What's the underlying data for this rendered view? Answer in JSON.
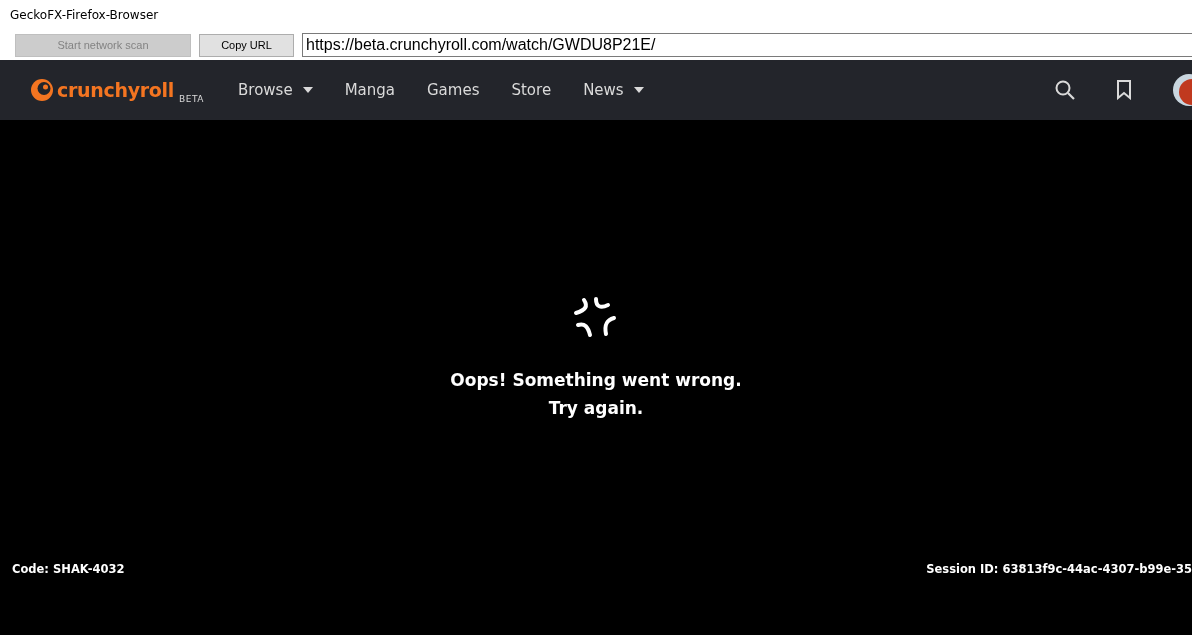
{
  "window": {
    "title": "GeckoFX-Firefox-Browser"
  },
  "toolbar": {
    "buttons": [
      {
        "label": "Start network scan",
        "disabled": true
      },
      {
        "label": "Copy URL",
        "disabled": false
      }
    ],
    "url": "https://beta.crunchyroll.com/watch/GWDU8P21E/"
  },
  "nav": {
    "logo": "crunchyroll",
    "badge": "BETA",
    "items": [
      {
        "label": "Browse",
        "dropdown": true
      },
      {
        "label": "Manga",
        "dropdown": false
      },
      {
        "label": "Games",
        "dropdown": false
      },
      {
        "label": "Store",
        "dropdown": false
      },
      {
        "label": "News",
        "dropdown": true
      }
    ]
  },
  "error": {
    "lines": [
      "Oops! Something went wrong.",
      "Try again."
    ],
    "code": "Code: SHAK-4032",
    "session": "Session ID: 63813f9c-44ac-4307-b99e-35"
  }
}
